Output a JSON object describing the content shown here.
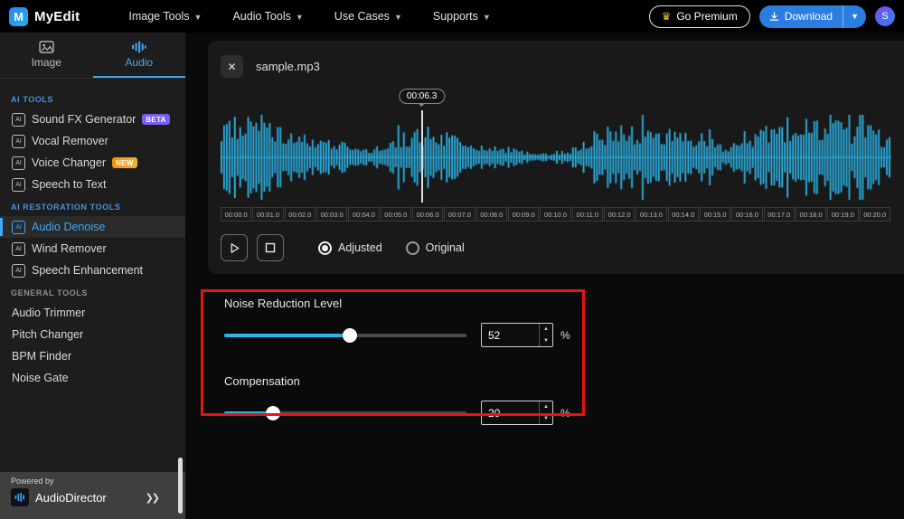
{
  "topbar": {
    "brand": "MyEdit",
    "logo_letter": "M",
    "nav": [
      {
        "label": "Image Tools"
      },
      {
        "label": "Audio Tools"
      },
      {
        "label": "Use Cases"
      },
      {
        "label": "Supports"
      }
    ],
    "premium_label": "Go Premium",
    "download_label": "Download",
    "avatar_initial": "S"
  },
  "sidebar": {
    "tabs": [
      {
        "label": "Image"
      },
      {
        "label": "Audio",
        "active": true
      }
    ],
    "sections": [
      {
        "title": "AI TOOLS",
        "items": [
          {
            "label": "Sound FX Generator",
            "badge": "BETA"
          },
          {
            "label": "Vocal Remover"
          },
          {
            "label": "Voice Changer",
            "badge": "NEW"
          },
          {
            "label": "Speech to Text"
          }
        ]
      },
      {
        "title": "AI RESTORATION TOOLS",
        "items": [
          {
            "label": "Audio Denoise",
            "selected": true
          },
          {
            "label": "Wind Remover"
          },
          {
            "label": "Speech Enhancement"
          }
        ]
      },
      {
        "title": "GENERAL TOOLS",
        "items": [
          {
            "label": "Audio Trimmer"
          },
          {
            "label": "Pitch Changer"
          },
          {
            "label": "BPM Finder"
          },
          {
            "label": "Noise Gate"
          }
        ]
      }
    ],
    "footer": {
      "powered_by": "Powered by",
      "product": "AudioDirector"
    }
  },
  "player": {
    "filename": "sample.mp3",
    "playhead_time": "00:06.3",
    "playhead_seconds": 6.3,
    "ruler": [
      "00:00.0",
      "00:01.0",
      "00:02.0",
      "00:03.0",
      "00:04.0",
      "00:05.0",
      "00:06.0",
      "00:07.0",
      "00:08.0",
      "00:09.0",
      "00:10.0",
      "00:11.0",
      "00:12.0",
      "00:13.0",
      "00:14.0",
      "00:15.0",
      "00:16.0",
      "00:17.0",
      "00:18.0",
      "00:19.0",
      "00:20.0"
    ],
    "ruler_span_seconds": 21,
    "modes": [
      {
        "label": "Adjusted",
        "selected": true
      },
      {
        "label": "Original",
        "selected": false
      }
    ]
  },
  "controls": {
    "noise_reduction": {
      "label": "Noise Reduction Level",
      "value": "52",
      "unit": "%"
    },
    "compensation": {
      "label": "Compensation",
      "value": "20",
      "unit": "%"
    }
  },
  "waveform": {
    "bars": 250,
    "seed": 987654321
  },
  "colors": {
    "accent": "#2db4e8",
    "selected_blue": "#3fa9f5",
    "download_blue": "#2a7de1",
    "annotation_red": "#e81414"
  }
}
